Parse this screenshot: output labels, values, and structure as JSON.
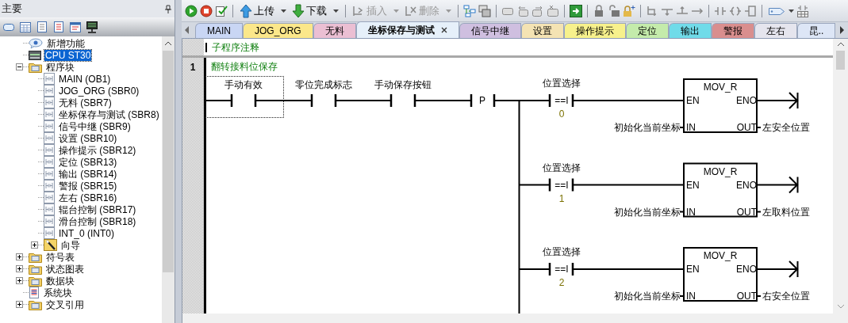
{
  "left_panel": {
    "title": "主要",
    "tree": [
      {
        "label": "新增功能",
        "kind": "help",
        "selected": false
      },
      {
        "label": "CPU ST30",
        "kind": "cpu",
        "selected": true
      },
      {
        "label": "程序块",
        "kind": "folder",
        "selected": false,
        "expanded": true,
        "children": [
          {
            "label": "MAIN (OB1)",
            "kind": "block",
            "selected": false
          },
          {
            "label": "JOG_ORG (SBR0)",
            "kind": "block",
            "selected": false
          },
          {
            "label": "无料 (SBR7)",
            "kind": "block",
            "selected": false
          },
          {
            "label": "坐标保存与测试 (SBR8)",
            "kind": "block",
            "selected": false
          },
          {
            "label": "信号中继 (SBR9)",
            "kind": "block",
            "selected": false
          },
          {
            "label": "设置 (SBR10)",
            "kind": "block",
            "selected": false
          },
          {
            "label": "操作提示 (SBR12)",
            "kind": "block",
            "selected": false
          },
          {
            "label": "定位 (SBR13)",
            "kind": "block",
            "selected": false
          },
          {
            "label": "输出 (SBR14)",
            "kind": "block",
            "selected": false
          },
          {
            "label": "警报 (SBR15)",
            "kind": "block",
            "selected": false
          },
          {
            "label": "左右 (SBR16)",
            "kind": "block",
            "selected": false
          },
          {
            "label": "辊台控制 (SBR17)",
            "kind": "block",
            "selected": false
          },
          {
            "label": "滑台控制 (SBR18)",
            "kind": "block",
            "selected": false
          },
          {
            "label": "INT_0 (INT0)",
            "kind": "block",
            "selected": false
          },
          {
            "label": "向导",
            "kind": "wizard",
            "selected": false,
            "expanded": false
          }
        ]
      },
      {
        "label": "符号表",
        "kind": "folder",
        "selected": false,
        "expanded": false
      },
      {
        "label": "状态图表",
        "kind": "folder",
        "selected": false,
        "expanded": false
      },
      {
        "label": "数据块",
        "kind": "folder",
        "selected": false,
        "expanded": false
      },
      {
        "label": "系统块",
        "kind": "system",
        "selected": false
      },
      {
        "label": "交叉引用",
        "kind": "folder",
        "selected": false,
        "expanded": false
      }
    ]
  },
  "toolbar": {
    "actions": [
      {
        "label": "上传",
        "disabled": false
      },
      {
        "label": "下载",
        "disabled": false
      },
      {
        "label": "插入",
        "disabled": true
      },
      {
        "label": "删除",
        "disabled": true
      }
    ]
  },
  "tabs": [
    {
      "label": "MAIN",
      "color": "#c9d6f4",
      "selected": false
    },
    {
      "label": "JOG_ORG",
      "color": "#fbe78a",
      "selected": false
    },
    {
      "label": "无料",
      "color": "#ebbfd3",
      "selected": false
    },
    {
      "label": "坐标保存与测试",
      "color": "#e6f0fa",
      "selected": true
    },
    {
      "label": "信号中继",
      "color": "#cfbfe0",
      "selected": false
    },
    {
      "label": "设置",
      "color": "#f4e3b3",
      "selected": false
    },
    {
      "label": "操作提示",
      "color": "#f7f18c",
      "selected": false
    },
    {
      "label": "定位",
      "color": "#c4ebab",
      "selected": false
    },
    {
      "label": "输出",
      "color": "#70dbe9",
      "selected": false
    },
    {
      "label": "警报",
      "color": "#d98e8e",
      "selected": false
    },
    {
      "label": "左右",
      "color": "#e5e5ee",
      "selected": false
    },
    {
      "label": "昆..",
      "color": "#dde6f6",
      "selected": false
    }
  ],
  "editor": {
    "comment": "子程序注释",
    "network": {
      "number": "1",
      "title": "翻转接料位保存",
      "contacts": [
        {
          "kind": "contact",
          "label": "手动有效",
          "selected": true
        },
        {
          "kind": "contact",
          "label": "零位完成标志",
          "selected": false
        },
        {
          "kind": "contact",
          "label": "手动保存按钮",
          "selected": false
        },
        {
          "kind": "edge",
          "label": "P",
          "selected": false
        }
      ],
      "branches": [
        {
          "compare_label": "位置选择",
          "operator": "==I",
          "operand": "0",
          "block": "MOV_R",
          "pins": [
            "EN",
            "ENO",
            "IN",
            "OUT"
          ],
          "in_operand": "初始化当前坐标",
          "out_operand": "左安全位置"
        },
        {
          "compare_label": "位置选择",
          "operator": "==I",
          "operand": "1",
          "block": "MOV_R",
          "pins": [
            "EN",
            "ENO",
            "IN",
            "OUT"
          ],
          "in_operand": "初始化当前坐标",
          "out_operand": "左取料位置"
        },
        {
          "compare_label": "位置选择",
          "operator": "==I",
          "operand": "2",
          "block": "MOV_R",
          "pins": [
            "EN",
            "ENO",
            "IN",
            "OUT"
          ],
          "in_operand": "初始化当前坐标",
          "out_operand": "右安全位置"
        }
      ]
    }
  }
}
